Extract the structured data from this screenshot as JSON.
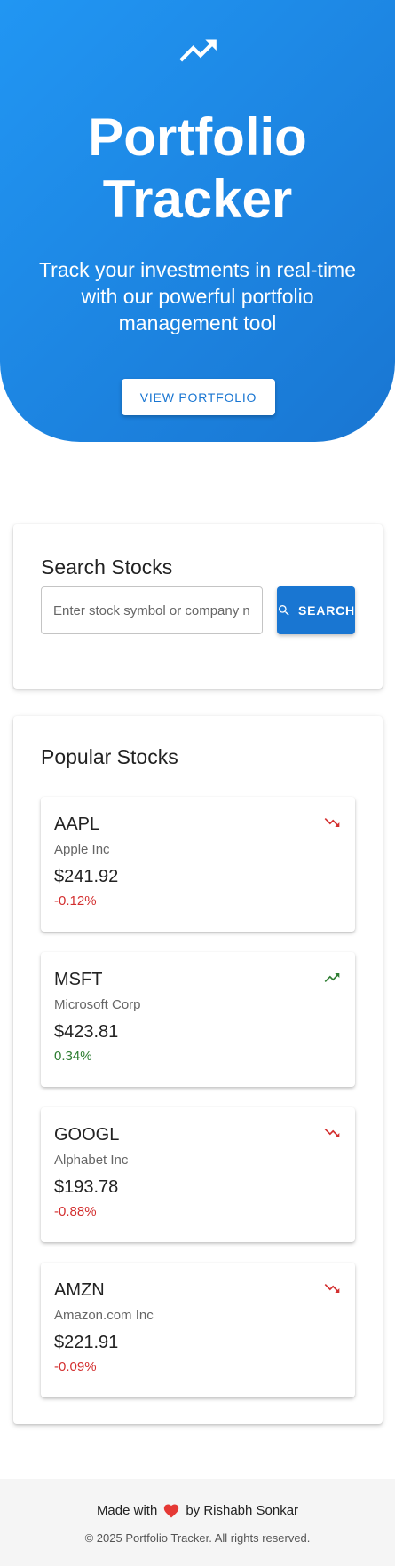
{
  "hero": {
    "icon": "trending-up-icon",
    "title_line1": "Portfolio",
    "title_line2": "Tracker",
    "subtitle": "Track your investments in real-time with our powerful portfolio management tool",
    "button_label": "VIEW PORTFOLIO"
  },
  "search": {
    "title": "Search Stocks",
    "placeholder": "Enter stock symbol or company name",
    "button_label": "SEARCH",
    "button_icon": "search-icon"
  },
  "popular": {
    "title": "Popular Stocks",
    "stocks": [
      {
        "symbol": "AAPL",
        "name": "Apple Inc",
        "price": "$241.92",
        "change": "-0.12%",
        "trend": "down"
      },
      {
        "symbol": "MSFT",
        "name": "Microsoft Corp",
        "price": "$423.81",
        "change": "0.34%",
        "trend": "up"
      },
      {
        "symbol": "GOOGL",
        "name": "Alphabet Inc",
        "price": "$193.78",
        "change": "-0.88%",
        "trend": "down"
      },
      {
        "symbol": "AMZN",
        "name": "Amazon.com Inc",
        "price": "$221.91",
        "change": "-0.09%",
        "trend": "down"
      }
    ]
  },
  "footer": {
    "made_with": "Made with",
    "heart_icon": "heart-icon",
    "by": "by Rishabh Sonkar",
    "copyright": "© 2025 Portfolio Tracker. All rights reserved."
  },
  "colors": {
    "primary": "#1976d2",
    "primary_light": "#2196f3",
    "up": "#2e7d32",
    "down": "#d32f2f",
    "heart": "#e53935"
  }
}
